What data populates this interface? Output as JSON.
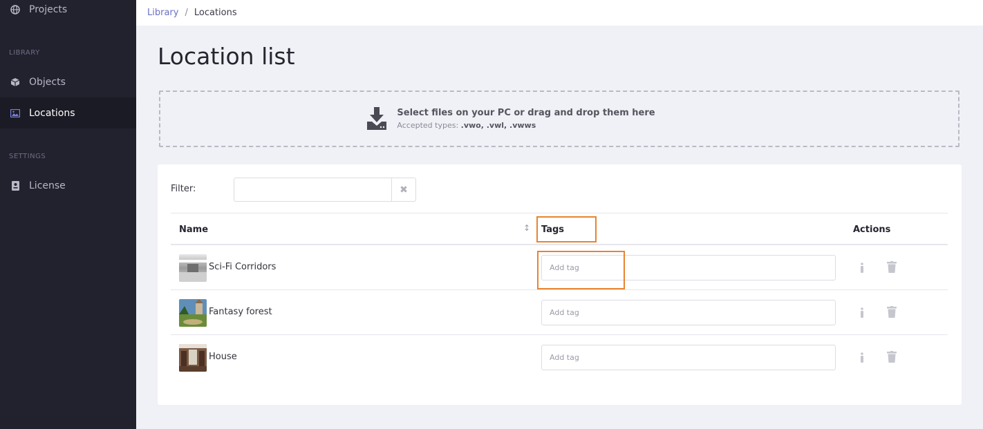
{
  "sidebar": {
    "items": [
      {
        "label": "Projects",
        "icon": "globe-icon"
      },
      {
        "label": "Objects",
        "icon": "cube-icon"
      },
      {
        "label": "Locations",
        "icon": "image-icon",
        "active": true
      },
      {
        "label": "License",
        "icon": "license-icon"
      }
    ],
    "sections": {
      "library": "LIBRARY",
      "settings": "SETTINGS"
    }
  },
  "breadcrumb": {
    "parent": "Library",
    "separator": "/",
    "current": "Locations"
  },
  "page": {
    "title": "Location list"
  },
  "upload": {
    "main_text": "Select files on your PC or drag and drop them here",
    "accepted_prefix": "Accepted types:",
    "accepted_types": ".vwo, .vwl, .vwws"
  },
  "filter": {
    "label": "Filter:",
    "value": "",
    "clear_icon": "close-icon"
  },
  "table": {
    "headers": {
      "name": "Name",
      "tags": "Tags",
      "actions": "Actions"
    },
    "rows": [
      {
        "name": "Sci-Fi Corridors",
        "tag_placeholder": "Add tag"
      },
      {
        "name": "Fantasy forest",
        "tag_placeholder": "Add tag"
      },
      {
        "name": "House",
        "tag_placeholder": "Add tag"
      }
    ]
  },
  "colors": {
    "accent": "#6a70c4",
    "highlight": "#e8832f",
    "sidebar_bg": "#22222f"
  }
}
